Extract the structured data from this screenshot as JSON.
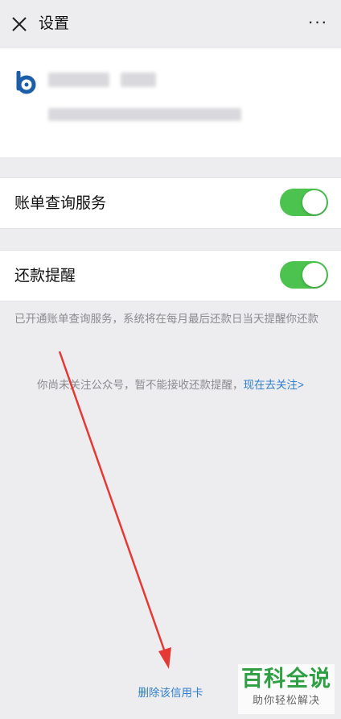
{
  "header": {
    "title": "设置",
    "close_icon": "close-icon",
    "more_icon": "more-icon",
    "more_label": "···"
  },
  "card": {
    "logo_icon": "bank-logo-icon",
    "logo_color": "#1d5ea8"
  },
  "settings": {
    "bill_query": {
      "label": "账单查询服务",
      "enabled": true
    },
    "repay_reminder": {
      "label": "还款提醒",
      "enabled": true
    }
  },
  "note": "已开通账单查询服务，系统将在每月最后还款日当天提醒你还款",
  "follow": {
    "text": "你尚未关注公众号，暂不能接收还款提醒，",
    "link": "现在去关注>"
  },
  "delete_label": "删除该信用卡",
  "watermark": {
    "title": "百科全说",
    "subtitle": "助你轻松解决"
  },
  "colors": {
    "toggle_on": "#4cc24f",
    "link": "#2f7ecb",
    "annotation_arrow": "#e53935",
    "watermark_green": "#2ea043"
  }
}
